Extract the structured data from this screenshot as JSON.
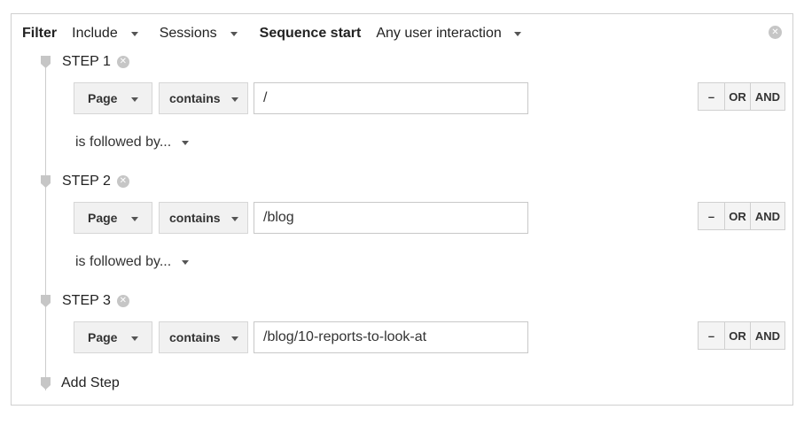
{
  "header": {
    "filter_label": "Filter",
    "include_value": "Include",
    "scope_value": "Sessions",
    "sequence_start_label": "Sequence start",
    "sequence_start_value": "Any user interaction",
    "close_icon": "close-circle-icon"
  },
  "steps": [
    {
      "label": "STEP 1",
      "dimension": "Page",
      "operator": "contains",
      "value": "/"
    },
    {
      "label": "STEP 2",
      "dimension": "Page",
      "operator": "contains",
      "value": "/blog"
    },
    {
      "label": "STEP 3",
      "dimension": "Page",
      "operator": "contains",
      "value": "/blog/10-reports-to-look-at"
    }
  ],
  "buttons": {
    "remove": "–",
    "or": "OR",
    "and": "AND"
  },
  "followed_by": "is followed by...",
  "add_step": "Add Step",
  "icons": {
    "step_marker": "step-marker-icon",
    "remove_step": "close-circle-icon",
    "dropdown": "chevron-down-icon"
  },
  "colors": {
    "border": "#cfcfcf",
    "button_bg": "#f4f4f4",
    "icon_grey": "#c6c6c6",
    "text": "#222222"
  }
}
